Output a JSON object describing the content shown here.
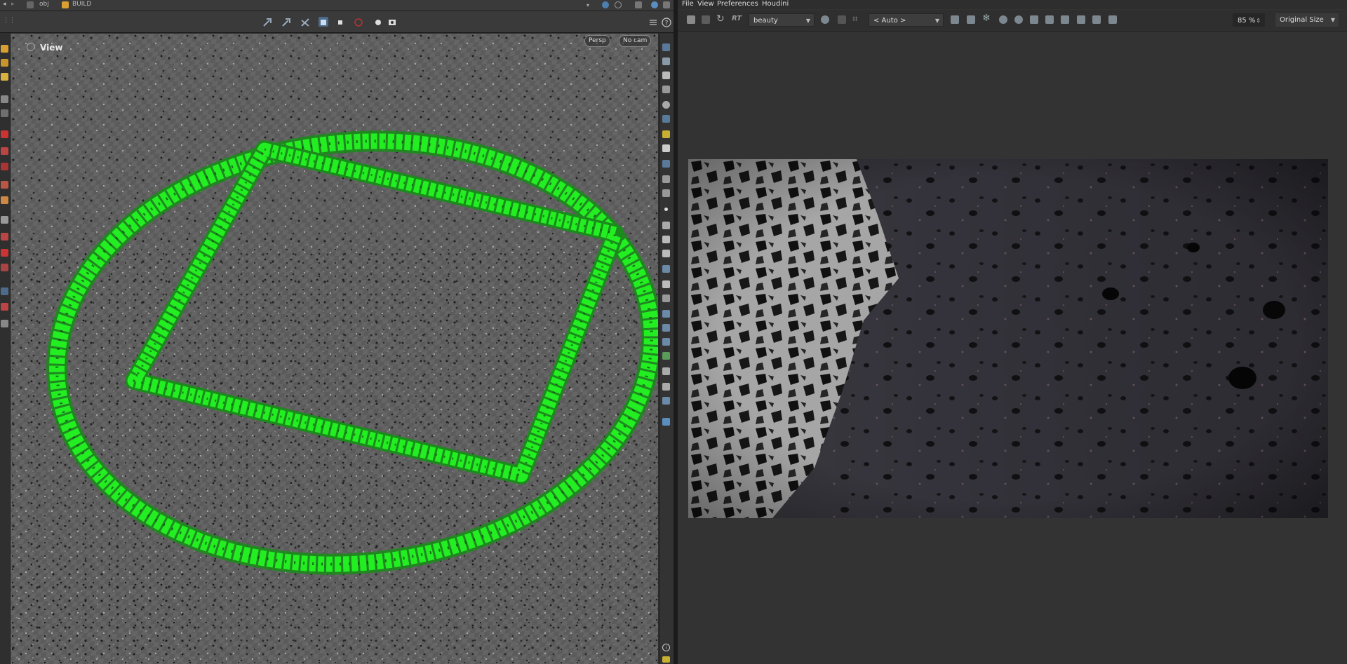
{
  "path_bar": {
    "obj_label": "obj",
    "build_label": "BUILD"
  },
  "viewport": {
    "view_label": "View",
    "camera_mode": "Persp",
    "camera_name": "No cam",
    "overlay_color": "#22ee22"
  },
  "render_view": {
    "menu": [
      "File",
      "View",
      "Preferences",
      "Houdini"
    ],
    "rt_label": "RT",
    "aov": "beauty",
    "resolution": "< Auto >",
    "zoom": "85 %",
    "size_mode": "Original Size"
  },
  "icons": {
    "back": "back-arrow-icon",
    "forward": "forward-arrow-icon",
    "help": "help-icon",
    "info": "info-icon",
    "lock": "lock-icon",
    "snowflake": "freeze-icon",
    "refresh": "refresh-icon",
    "crop": "crop-icon"
  },
  "colors": {
    "panel_bg": "#333333",
    "toolbar_bg": "#2f2f2f",
    "accent_green": "#22ee22",
    "icon_blue": "#8a9aa8"
  }
}
